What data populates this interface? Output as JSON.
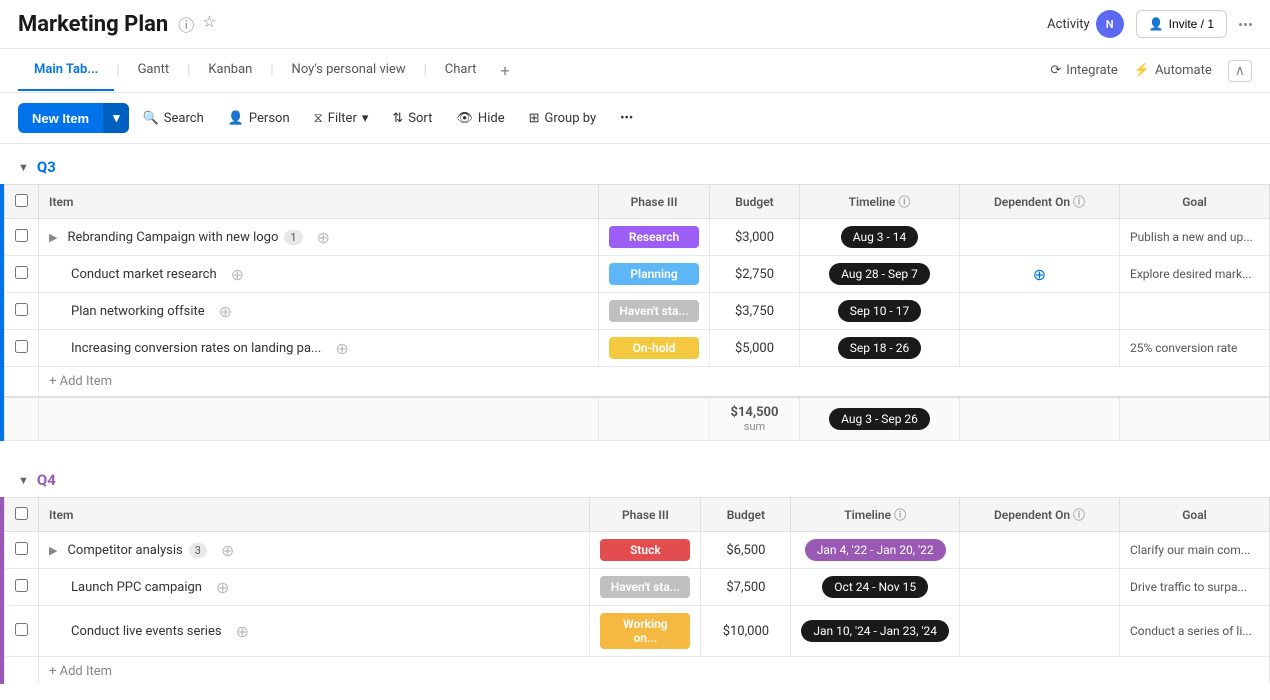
{
  "header": {
    "title": "Marketing Plan",
    "activity_label": "Activity",
    "invite_label": "Invite / 1"
  },
  "tabs": [
    {
      "label": "Main Tab...",
      "active": true
    },
    {
      "label": "Gantt",
      "active": false
    },
    {
      "label": "Kanban",
      "active": false
    },
    {
      "label": "Noy's personal view",
      "active": false
    },
    {
      "label": "Chart",
      "active": false
    }
  ],
  "tabs_right": {
    "integrate": "Integrate",
    "automate": "Automate"
  },
  "toolbar": {
    "new_item": "New Item",
    "search": "Search",
    "person": "Person",
    "filter": "Filter",
    "sort": "Sort",
    "hide": "Hide",
    "group_by": "Group by"
  },
  "groups": [
    {
      "id": "q3",
      "label": "Q3",
      "color": "#0073ea",
      "columns": [
        "Item",
        "Phase III",
        "Budget",
        "Timeline",
        "Dependent On",
        "Goal"
      ],
      "rows": [
        {
          "id": 1,
          "expandable": true,
          "name": "Rebranding Campaign with new logo",
          "badge": "1",
          "phase": "Research",
          "phase_class": "phase-research",
          "budget": "$3,000",
          "timeline": "Aug 3 - 14",
          "timeline_class": "dark",
          "dependent_on": "",
          "goal": "Publish a new and up..."
        },
        {
          "id": 2,
          "expandable": false,
          "name": "Conduct market research",
          "badge": "",
          "phase": "Planning",
          "phase_class": "phase-planning",
          "budget": "$2,750",
          "timeline": "Aug 28 - Sep 7",
          "timeline_class": "dark",
          "dependent_on": "plus",
          "goal": "Explore desired mark..."
        },
        {
          "id": 3,
          "expandable": false,
          "name": "Plan networking offsite",
          "badge": "",
          "phase": "Haven't sta...",
          "phase_class": "phase-haventst",
          "budget": "$3,750",
          "timeline": "Sep 10 - 17",
          "timeline_class": "dark",
          "dependent_on": "",
          "goal": ""
        },
        {
          "id": 4,
          "expandable": false,
          "name": "Increasing conversion rates on landing pa...",
          "badge": "",
          "phase": "On-hold",
          "phase_class": "phase-onhold",
          "budget": "$5,000",
          "timeline": "Sep 18 - 26",
          "timeline_class": "dark",
          "dependent_on": "",
          "goal": "25% conversion rate"
        }
      ],
      "summary": {
        "budget": "$14,500",
        "budget_label": "sum",
        "timeline": "Aug 3 - Sep 26"
      },
      "add_item": "+ Add Item"
    },
    {
      "id": "q4",
      "label": "Q4",
      "color": "#9b59b6",
      "columns": [
        "Item",
        "Phase III",
        "Budget",
        "Timeline",
        "Dependent On",
        "Goal"
      ],
      "rows": [
        {
          "id": 1,
          "expandable": true,
          "name": "Competitor analysis",
          "badge": "3",
          "phase": "Stuck",
          "phase_class": "phase-stuck",
          "budget": "$6,500",
          "timeline": "Jan 4, '22 - Jan 20, '22",
          "timeline_class": "purple",
          "dependent_on": "",
          "goal": "Clarify our main com..."
        },
        {
          "id": 2,
          "expandable": false,
          "name": "Launch PPC campaign",
          "badge": "",
          "phase": "Haven't sta...",
          "phase_class": "phase-haventst",
          "budget": "$7,500",
          "timeline": "Oct 24 - Nov 15",
          "timeline_class": "dark",
          "dependent_on": "",
          "goal": "Drive traffic to surpa..."
        },
        {
          "id": 3,
          "expandable": false,
          "name": "Conduct live events series",
          "badge": "",
          "phase": "Working on...",
          "phase_class": "phase-workingon",
          "budget": "$10,000",
          "timeline": "Jan 10, '24 - Jan 23, '24",
          "timeline_class": "dark",
          "dependent_on": "",
          "goal": "Conduct a series of li..."
        }
      ],
      "summary": null,
      "add_item": "+ Add Item"
    }
  ]
}
